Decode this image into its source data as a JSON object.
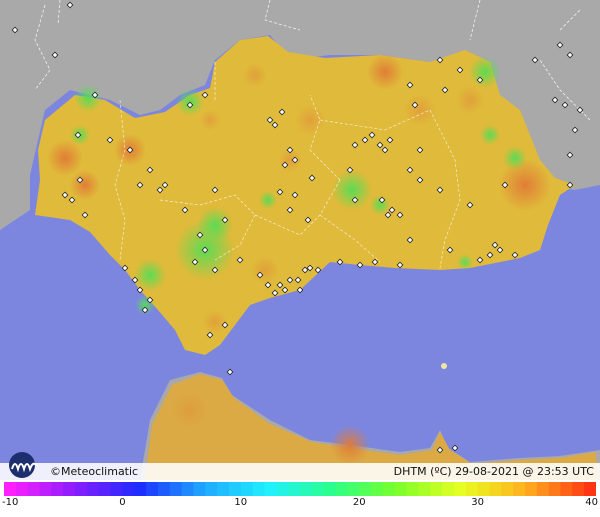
{
  "map": {
    "brand": "©Meteoclimatic",
    "variable": "DHTM (ºC)",
    "timestamp": "29-08-2021 @ 23:53 UTC",
    "colors": {
      "sea": "#7c86df",
      "land_outside": "#a9a9a9",
      "base_land": "#e0ba3a",
      "hot": "#e07f3a",
      "cool": "#7fd84a",
      "station_marker": "#ffffff"
    }
  },
  "colorbar": {
    "ticks": [
      "-10",
      "0",
      "10",
      "20",
      "30",
      "40"
    ],
    "range": [
      -10,
      40
    ],
    "gradient": [
      "#ff20ff",
      "#8a1cff",
      "#1e2bff",
      "#1fa8ff",
      "#20f0ff",
      "#2aff8a",
      "#7bff2a",
      "#e8ff22",
      "#ffb01f",
      "#ff3412"
    ]
  }
}
